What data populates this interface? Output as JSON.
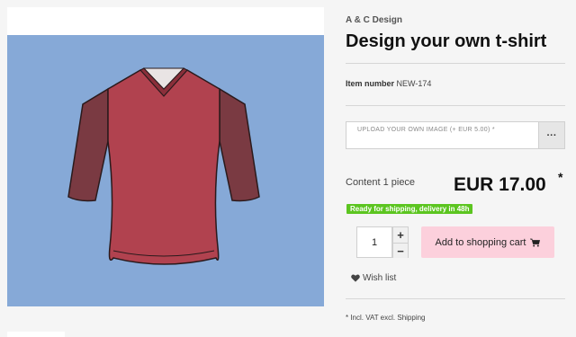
{
  "product": {
    "brand": "A & C Design",
    "title": "Design your own t-shirt",
    "item_number_label": "Item number",
    "item_number": "NEW-174",
    "upload_label": "UPLOAD YOUR OWN IMAGE (+ EUR 5.00) *",
    "upload_button_label": "···",
    "content_text": "Content 1 piece",
    "price": "EUR 17.00",
    "price_marker": "*",
    "availability_badge": "Ready for shipping, delivery in 48h",
    "quantity_value": "1",
    "quantity_increase_label": "+",
    "quantity_decrease_label": "−",
    "add_to_cart_label": "Add to shopping cart",
    "wishlist_label": "Wish list",
    "vat_note": "* Incl. VAT excl. Shipping"
  },
  "icons": {
    "upload_button": "more-dots-icon",
    "cart": "shopping-cart-icon",
    "wishlist": "heart-icon"
  },
  "colors": {
    "image_background": "#86a9d7",
    "shirt_body": "#b1424f",
    "shirt_sleeves": "#7a3a42",
    "availability_badge": "#5cc520",
    "cart_button": "#fcd0dc"
  }
}
